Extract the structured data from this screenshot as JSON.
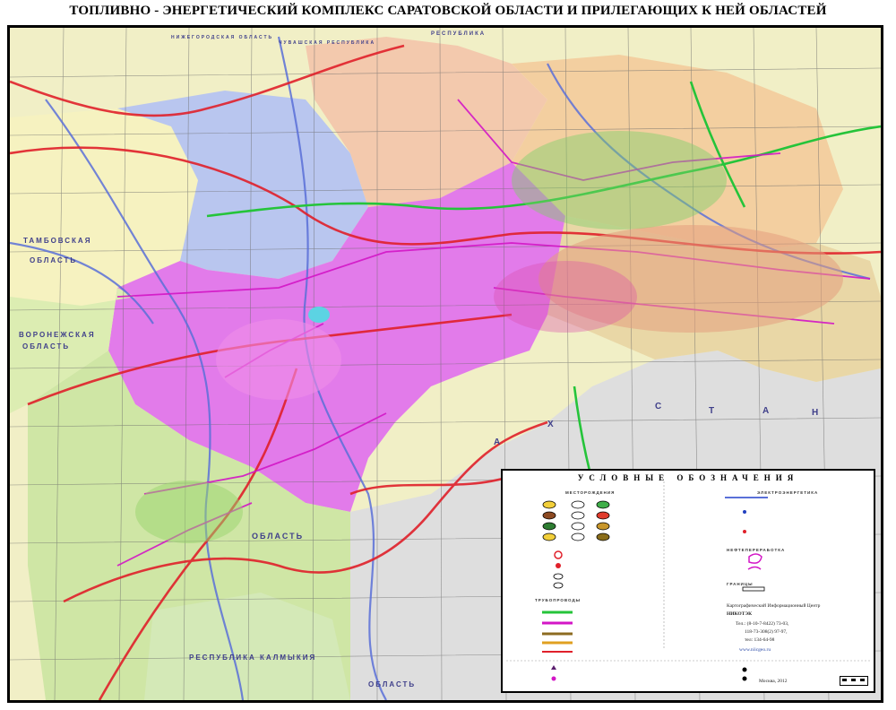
{
  "title": "ТОПЛИВНО - ЭНЕРГЕТИЧЕСКИЙ КОМПЛЕКС САРАТОВСКОЙ ОБЛАСТИ И ПРИЛЕГАЮЩИХ К НЕЙ ОБЛАСТЕЙ",
  "map_labels": {
    "tambov": "ТАМБОВСКАЯ",
    "tambov_oblast": "ОБЛАСТЬ",
    "voronezh": "ВОРОНЕЖСКАЯ",
    "voronezh_oblast": "ОБЛАСТЬ",
    "kazakhstan_1": "А",
    "kazakhstan_2": "Х",
    "kazakhstan_3": "С",
    "kazakhstan_4": "Т",
    "kazakhstan_5": "А",
    "kazakhstan_6": "Н",
    "volgograd_oblast": "ОБЛАСТЬ",
    "kalmykia": "РЕСПУБЛИКА КАЛМЫКИЯ",
    "bottom_oblast": "ОБЛАСТЬ",
    "top_resp": "РЕСПУБЛИКА",
    "top_chuvash": "ЧУВАШСКАЯ РЕСПУБЛИКА",
    "top_nizhegorod": "НИЖЕГОРОДСКАЯ ОБЛАСТЬ"
  },
  "legend": {
    "title": "УСЛОВНЫЕ ОБОЗНАЧЕНИЯ",
    "section_deposits": "МЕСТОРОЖДЕНИЯ",
    "section_energy": "ЭЛЕКТРОЭНЕРГЕТИКА",
    "section_pipelines": "ТРУБОПРОВОДЫ",
    "section_refining": "НЕФТЕПЕРЕРАБОТКА",
    "section_borders": "ГРАНИЦЫ",
    "org_name": "Картографический Информационный Центр",
    "org_short": "НИКОТЭК",
    "phone_1": "Тел.: (8-10-7-8422) 73-03,",
    "phone_2": "118-73-308(2) 97-97,",
    "phone_3": "тел: 134-64-98",
    "website": "www.niicgeo.ru",
    "city": "Москва, 2012"
  },
  "colors": {
    "saratov_fill": "#e27bea",
    "neighbor_blue": "#b9c6ef",
    "neighbor_green": "#cfe6a5",
    "neighbor_peach": "#f3c9ad",
    "kazakhstan_fill": "#dcdcdc",
    "road_red": "#e0202a",
    "pipeline_magenta": "#d316c6",
    "pipeline_green": "#25c43a",
    "river_blue": "#5a70d8"
  }
}
